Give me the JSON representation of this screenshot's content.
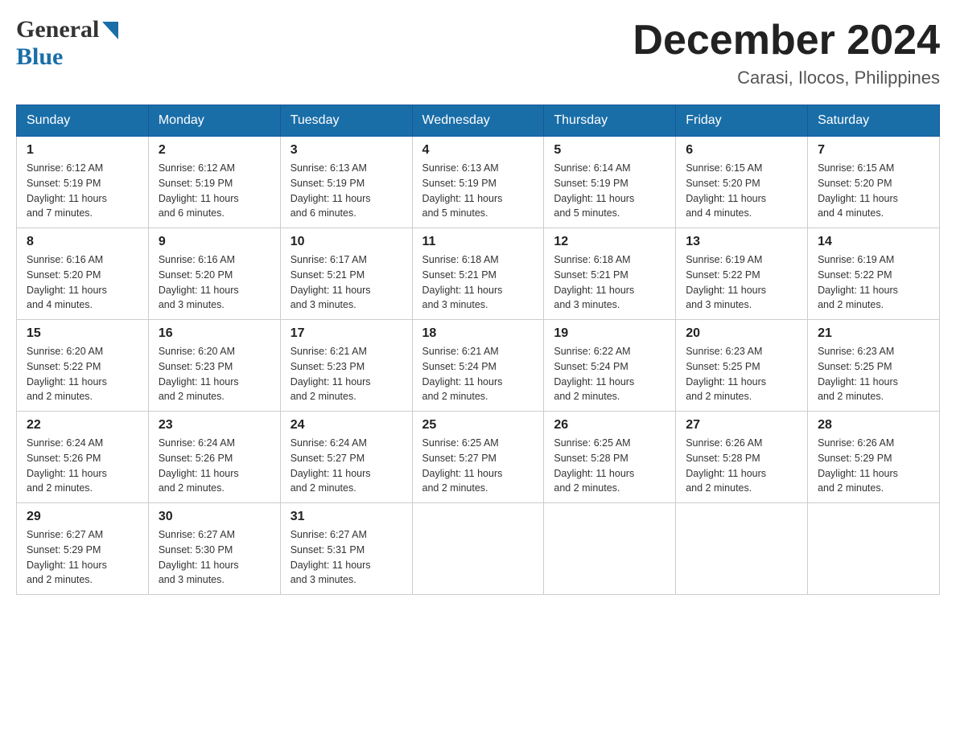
{
  "header": {
    "logo_general": "General",
    "logo_blue": "Blue",
    "month_title": "December 2024",
    "location": "Carasi, Ilocos, Philippines"
  },
  "days_of_week": [
    "Sunday",
    "Monday",
    "Tuesday",
    "Wednesday",
    "Thursday",
    "Friday",
    "Saturday"
  ],
  "weeks": [
    [
      {
        "day": "1",
        "sunrise": "6:12 AM",
        "sunset": "5:19 PM",
        "daylight": "11 hours and 7 minutes."
      },
      {
        "day": "2",
        "sunrise": "6:12 AM",
        "sunset": "5:19 PM",
        "daylight": "11 hours and 6 minutes."
      },
      {
        "day": "3",
        "sunrise": "6:13 AM",
        "sunset": "5:19 PM",
        "daylight": "11 hours and 6 minutes."
      },
      {
        "day": "4",
        "sunrise": "6:13 AM",
        "sunset": "5:19 PM",
        "daylight": "11 hours and 5 minutes."
      },
      {
        "day": "5",
        "sunrise": "6:14 AM",
        "sunset": "5:19 PM",
        "daylight": "11 hours and 5 minutes."
      },
      {
        "day": "6",
        "sunrise": "6:15 AM",
        "sunset": "5:20 PM",
        "daylight": "11 hours and 4 minutes."
      },
      {
        "day": "7",
        "sunrise": "6:15 AM",
        "sunset": "5:20 PM",
        "daylight": "11 hours and 4 minutes."
      }
    ],
    [
      {
        "day": "8",
        "sunrise": "6:16 AM",
        "sunset": "5:20 PM",
        "daylight": "11 hours and 4 minutes."
      },
      {
        "day": "9",
        "sunrise": "6:16 AM",
        "sunset": "5:20 PM",
        "daylight": "11 hours and 3 minutes."
      },
      {
        "day": "10",
        "sunrise": "6:17 AM",
        "sunset": "5:21 PM",
        "daylight": "11 hours and 3 minutes."
      },
      {
        "day": "11",
        "sunrise": "6:18 AM",
        "sunset": "5:21 PM",
        "daylight": "11 hours and 3 minutes."
      },
      {
        "day": "12",
        "sunrise": "6:18 AM",
        "sunset": "5:21 PM",
        "daylight": "11 hours and 3 minutes."
      },
      {
        "day": "13",
        "sunrise": "6:19 AM",
        "sunset": "5:22 PM",
        "daylight": "11 hours and 3 minutes."
      },
      {
        "day": "14",
        "sunrise": "6:19 AM",
        "sunset": "5:22 PM",
        "daylight": "11 hours and 2 minutes."
      }
    ],
    [
      {
        "day": "15",
        "sunrise": "6:20 AM",
        "sunset": "5:22 PM",
        "daylight": "11 hours and 2 minutes."
      },
      {
        "day": "16",
        "sunrise": "6:20 AM",
        "sunset": "5:23 PM",
        "daylight": "11 hours and 2 minutes."
      },
      {
        "day": "17",
        "sunrise": "6:21 AM",
        "sunset": "5:23 PM",
        "daylight": "11 hours and 2 minutes."
      },
      {
        "day": "18",
        "sunrise": "6:21 AM",
        "sunset": "5:24 PM",
        "daylight": "11 hours and 2 minutes."
      },
      {
        "day": "19",
        "sunrise": "6:22 AM",
        "sunset": "5:24 PM",
        "daylight": "11 hours and 2 minutes."
      },
      {
        "day": "20",
        "sunrise": "6:23 AM",
        "sunset": "5:25 PM",
        "daylight": "11 hours and 2 minutes."
      },
      {
        "day": "21",
        "sunrise": "6:23 AM",
        "sunset": "5:25 PM",
        "daylight": "11 hours and 2 minutes."
      }
    ],
    [
      {
        "day": "22",
        "sunrise": "6:24 AM",
        "sunset": "5:26 PM",
        "daylight": "11 hours and 2 minutes."
      },
      {
        "day": "23",
        "sunrise": "6:24 AM",
        "sunset": "5:26 PM",
        "daylight": "11 hours and 2 minutes."
      },
      {
        "day": "24",
        "sunrise": "6:24 AM",
        "sunset": "5:27 PM",
        "daylight": "11 hours and 2 minutes."
      },
      {
        "day": "25",
        "sunrise": "6:25 AM",
        "sunset": "5:27 PM",
        "daylight": "11 hours and 2 minutes."
      },
      {
        "day": "26",
        "sunrise": "6:25 AM",
        "sunset": "5:28 PM",
        "daylight": "11 hours and 2 minutes."
      },
      {
        "day": "27",
        "sunrise": "6:26 AM",
        "sunset": "5:28 PM",
        "daylight": "11 hours and 2 minutes."
      },
      {
        "day": "28",
        "sunrise": "6:26 AM",
        "sunset": "5:29 PM",
        "daylight": "11 hours and 2 minutes."
      }
    ],
    [
      {
        "day": "29",
        "sunrise": "6:27 AM",
        "sunset": "5:29 PM",
        "daylight": "11 hours and 2 minutes."
      },
      {
        "day": "30",
        "sunrise": "6:27 AM",
        "sunset": "5:30 PM",
        "daylight": "11 hours and 3 minutes."
      },
      {
        "day": "31",
        "sunrise": "6:27 AM",
        "sunset": "5:31 PM",
        "daylight": "11 hours and 3 minutes."
      },
      null,
      null,
      null,
      null
    ]
  ],
  "labels": {
    "sunrise": "Sunrise:",
    "sunset": "Sunset:",
    "daylight": "Daylight:"
  }
}
